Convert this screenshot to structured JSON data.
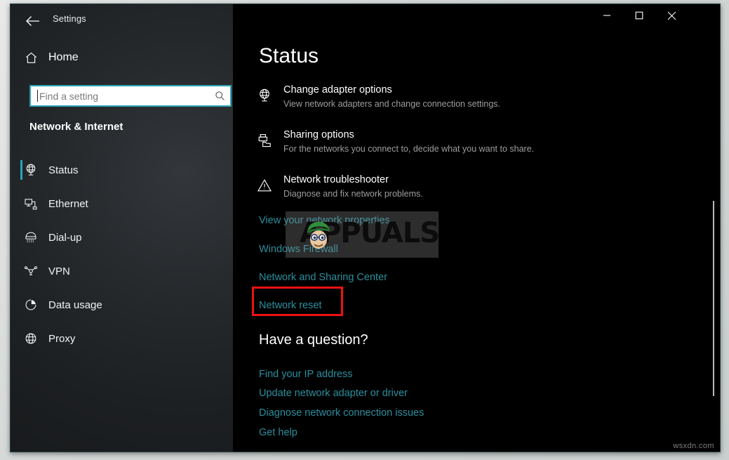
{
  "window": {
    "title": "Settings",
    "back_icon": "back-arrow-icon",
    "controls": [
      {
        "name": "minimize",
        "glyph": "—"
      },
      {
        "name": "maximize",
        "glyph": "□"
      },
      {
        "name": "close",
        "glyph": "✕"
      }
    ]
  },
  "sidebar": {
    "home_label": "Home",
    "home_icon": "home-icon",
    "search": {
      "placeholder": "Find a setting",
      "value": "",
      "icon": "search-icon"
    },
    "category_title": "Network & Internet",
    "items": [
      {
        "label": "Status",
        "icon": "globe-stand-icon",
        "selected": true
      },
      {
        "label": "Ethernet",
        "icon": "ethernet-icon",
        "selected": false
      },
      {
        "label": "Dial-up",
        "icon": "dialup-icon",
        "selected": false
      },
      {
        "label": "VPN",
        "icon": "vpn-icon",
        "selected": false
      },
      {
        "label": "Data usage",
        "icon": "pie-chart-icon",
        "selected": false
      },
      {
        "label": "Proxy",
        "icon": "globe-icon",
        "selected": false
      }
    ]
  },
  "main": {
    "page_title": "Status",
    "actions": [
      {
        "title": "Change adapter options",
        "desc": "View network adapters and change connection settings.",
        "icon": "globe-stand-icon"
      },
      {
        "title": "Sharing options",
        "desc": "For the networks you connect to, decide what you want to share.",
        "icon": "sharing-icon"
      },
      {
        "title": "Network troubleshooter",
        "desc": "Diagnose and fix network problems.",
        "icon": "warning-triangle-icon"
      }
    ],
    "links": [
      "View your network properties",
      "Windows Firewall",
      "Network and Sharing Center",
      "Network reset"
    ],
    "section_title": "Have a question?",
    "help_links": [
      "Find your IP address",
      "Update network adapter or driver",
      "Diagnose network connection issues",
      "Get help"
    ]
  },
  "annotation": {
    "highlight_target": "Network reset",
    "color": "#ee1111"
  },
  "watermarks": {
    "overlay_text": "APPUALS",
    "footer_text": "wsxdn.com"
  },
  "colors": {
    "accent": "#2aa3b5",
    "link": "#2a8f9e",
    "annotation": "#ee1111"
  }
}
